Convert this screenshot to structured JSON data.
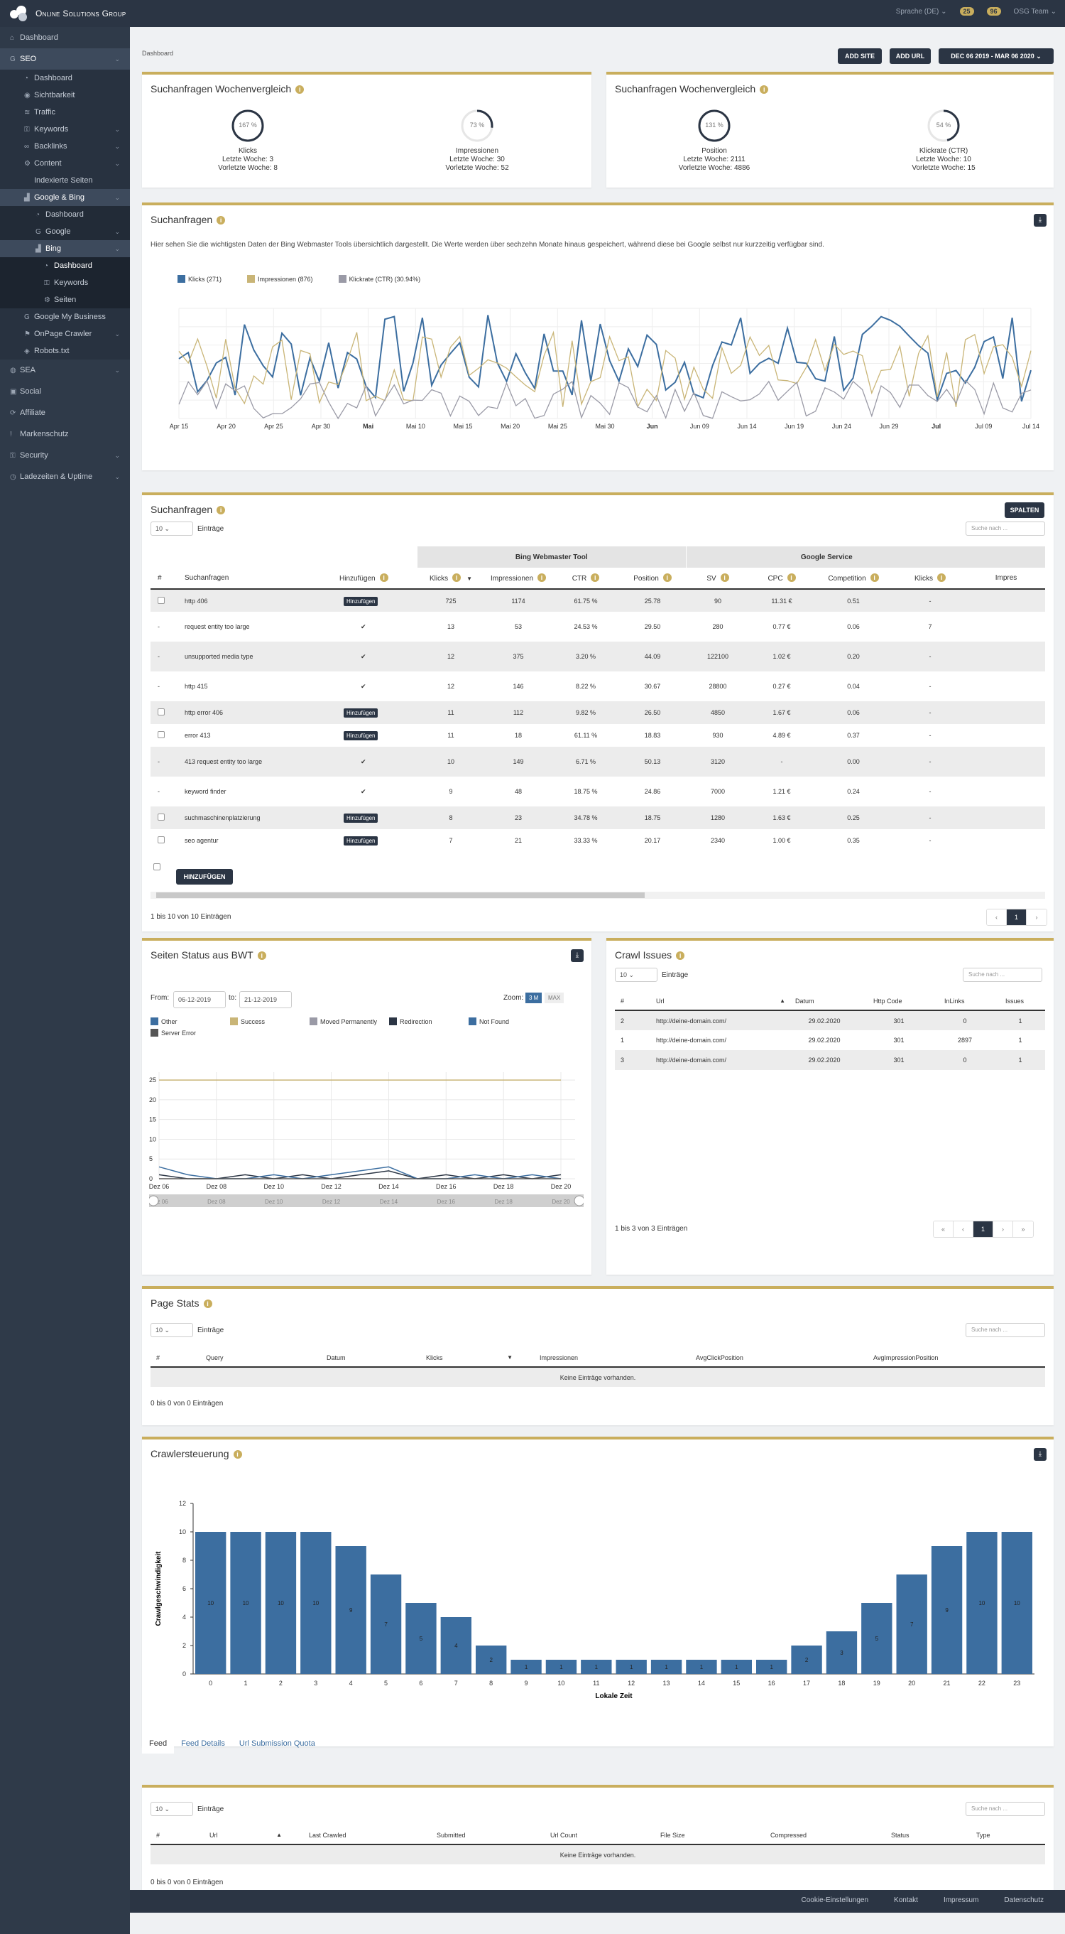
{
  "topbar": {
    "brand": "Online Solutions Group",
    "lang": "Sprache (DE)",
    "badge1": "25",
    "badge2": "96",
    "user": "OSG Team"
  },
  "sidebar": [
    {
      "label": "Dashboard",
      "icon": "home-icon",
      "level": 0
    },
    {
      "label": "SEO",
      "icon": "google-icon",
      "level": 0,
      "active": true,
      "chev": "⌄"
    },
    {
      "label": "Dashboard",
      "icon": "gauge-icon",
      "level": 1
    },
    {
      "label": "Sichtbarkeit",
      "icon": "eye-icon",
      "level": 1
    },
    {
      "label": "Traffic",
      "icon": "signal-icon",
      "level": 1
    },
    {
      "label": "Keywords",
      "icon": "key-icon",
      "level": 1,
      "chev": "⌄"
    },
    {
      "label": "Backlinks",
      "icon": "link-icon",
      "level": 1,
      "chev": "⌄"
    },
    {
      "label": "Content",
      "icon": "gear-icon",
      "level": 1,
      "chev": "⌄"
    },
    {
      "label": "Indexierte Seiten",
      "icon": "",
      "level": 1
    },
    {
      "label": "Google & Bing",
      "icon": "chart-icon",
      "level": 1,
      "active": true,
      "chev": "⌄"
    },
    {
      "label": "Dashboard",
      "icon": "gauge-icon",
      "level": 2
    },
    {
      "label": "Google",
      "icon": "google-icon",
      "level": 2,
      "chev": "⌄"
    },
    {
      "label": "Bing",
      "icon": "chart-icon",
      "level": 2,
      "active": true,
      "chev": "⌄"
    },
    {
      "label": "Dashboard",
      "icon": "gauge-icon",
      "level": 3,
      "active": true
    },
    {
      "label": "Keywords",
      "icon": "key-icon",
      "level": 3
    },
    {
      "label": "Seiten",
      "icon": "gear-icon",
      "level": 3
    },
    {
      "label": "Google My Business",
      "icon": "google-icon",
      "level": 1
    },
    {
      "label": "OnPage Crawler",
      "icon": "flag-icon",
      "level": 1,
      "chev": "⌄"
    },
    {
      "label": "Robots.txt",
      "icon": "robot-icon",
      "level": 1
    },
    {
      "label": "SEA",
      "icon": "globe-icon",
      "level": 0,
      "chev": "⌄"
    },
    {
      "label": "Social",
      "icon": "social-icon",
      "level": 0
    },
    {
      "label": "Affiliate",
      "icon": "affiliate-icon",
      "level": 0
    },
    {
      "label": "Markenschutz",
      "icon": "exclaim-icon",
      "level": 0
    },
    {
      "label": "Security",
      "icon": "lock-icon",
      "level": 0,
      "chev": "⌄"
    },
    {
      "label": "Ladezeiten & Uptime",
      "icon": "clock-icon",
      "level": 0,
      "chev": "⌄"
    }
  ],
  "header": {
    "breadcrumb": "Dashboard",
    "add_site": "ADD SITE",
    "add_url": "ADD URL",
    "date_range": "DEC 06 2019 - MAR 06 2020"
  },
  "weekly": [
    {
      "title": "Suchanfragen Wochenvergleich",
      "metrics": [
        {
          "pct": "167 %",
          "name": "Klicks",
          "last": "Letzte Woche: 3",
          "prev": "Vorletzte Woche: 8",
          "ratio": 1.0
        },
        {
          "pct": "73 %",
          "name": "Impressionen",
          "last": "Letzte Woche: 30",
          "prev": "Vorletzte Woche: 52",
          "ratio": 0.27
        }
      ]
    },
    {
      "title": "Suchanfragen Wochenvergleich",
      "metrics": [
        {
          "pct": "131 %",
          "name": "Position",
          "last": "Letzte Woche: 2111",
          "prev": "Vorletzte Woche: 4886",
          "ratio": 1.0
        },
        {
          "pct": "54 %",
          "name": "Klickrate (CTR)",
          "last": "Letzte Woche: 10",
          "prev": "Vorletzte Woche: 15",
          "ratio": 0.46
        }
      ]
    }
  ],
  "suchanfragen_chart": {
    "title": "Suchanfragen",
    "description": "Hier sehen Sie die wichtigsten Daten der Bing Webmaster Tools übersichtlich dargestellt. Die Werte werden über sechzehn Monate hinaus gespeichert, während diese bei Google selbst nur kurzzeitig verfügbar sind.",
    "legend": [
      "Klicks (271)",
      "Impressionen (876)",
      "Klickrate (CTR) (30.94%)"
    ]
  },
  "chart_data": [
    {
      "type": "line",
      "series": [
        {
          "name": "Klicks (271)",
          "color": "#3c6ea0"
        },
        {
          "name": "Impressionen (876)",
          "color": "#c9b577"
        },
        {
          "name": "Klickrate (CTR) (30.94%)",
          "color": "#9a9aa6"
        }
      ],
      "x": [
        "Apr 15",
        "Apr 20",
        "Apr 25",
        "Apr 30",
        "Mai",
        "Mai 10",
        "Mai 15",
        "Mai 20",
        "Mai 25",
        "Mai 30",
        "Jun",
        "Jun 09",
        "Jun 14",
        "Jun 19",
        "Jun 24",
        "Jun 29",
        "Jul",
        "Jul 09",
        "Jul 14"
      ]
    },
    {
      "type": "line",
      "title": "Seiten Status aus BWT",
      "series": [
        {
          "name": "Other",
          "color": "#3c6ea0"
        },
        {
          "name": "Success",
          "color": "#c9b577",
          "values": [
            25,
            25,
            25,
            25,
            25,
            25,
            25,
            25,
            25,
            25,
            25,
            25,
            25,
            25,
            25
          ]
        },
        {
          "name": "Moved Permanently",
          "color": "#9a9aa6"
        },
        {
          "name": "Redirection",
          "color": "#2b3544",
          "values": [
            1,
            0,
            0,
            1,
            0,
            1,
            0,
            1,
            2,
            0,
            1,
            0,
            1,
            0,
            1
          ]
        },
        {
          "name": "Not Found",
          "color": "#3c6ea0",
          "values": [
            3,
            1,
            0,
            0,
            1,
            0,
            1,
            2,
            3,
            0,
            0,
            1,
            0,
            1,
            0
          ]
        },
        {
          "name": "Server Error",
          "color": "#555",
          "values": [
            0,
            0,
            0,
            0,
            0,
            0,
            0,
            0,
            0,
            0,
            0,
            0,
            0,
            0,
            0
          ]
        }
      ],
      "x": [
        "Dez 06",
        "Dez 08",
        "Dez 10",
        "Dez 12",
        "Dez 14",
        "Dez 16",
        "Dez 18",
        "Dez 20"
      ],
      "yticks": [
        0,
        5,
        10,
        15,
        20,
        25
      ],
      "ylim": [
        0,
        27
      ]
    },
    {
      "type": "bar",
      "title": "Crawlersteuerung",
      "xlabel": "Lokale Zeit",
      "ylabel": "Crawlgeschwindigkeit",
      "categories": [
        "0",
        "1",
        "2",
        "3",
        "4",
        "5",
        "6",
        "7",
        "8",
        "9",
        "10",
        "11",
        "12",
        "13",
        "14",
        "15",
        "16",
        "17",
        "18",
        "19",
        "20",
        "21",
        "22",
        "23"
      ],
      "values": [
        10,
        10,
        10,
        10,
        9,
        7,
        5,
        4,
        2,
        1,
        1,
        1,
        1,
        1,
        1,
        1,
        1,
        2,
        3,
        5,
        7,
        9,
        10,
        10
      ],
      "yticks": [
        0,
        2,
        4,
        6,
        8,
        10,
        12
      ],
      "ylim": [
        0,
        12
      ],
      "color": "#3c6ea0"
    }
  ],
  "queries": {
    "title": "Suchanfragen",
    "spalten": "SPALTEN",
    "entries": "10",
    "entries_label": "Einträge",
    "search": "Suche nach ...",
    "group_bing": "Bing Webmaster Tool",
    "group_google": "Google Service",
    "cols": [
      "#",
      "Suchanfragen",
      "Hinzufügen",
      "Klicks",
      "Impressionen",
      "CTR",
      "Position",
      "SV",
      "CPC",
      "Competition",
      "Klicks",
      "Impres"
    ],
    "rows": [
      {
        "check": "box",
        "q": "http 406",
        "add": "Hinzufügen",
        "k": "725",
        "i": "1174",
        "ctr": "61.75 %",
        "pos": "25.78",
        "sv": "90",
        "cpc": "11.31 €",
        "comp": "0.51",
        "gk": "-"
      },
      {
        "check": "-",
        "q": "request entity too large",
        "add": "✔",
        "k": "13",
        "i": "53",
        "ctr": "24.53 %",
        "pos": "29.50",
        "sv": "280",
        "cpc": "0.77 €",
        "comp": "0.06",
        "gk": "7"
      },
      {
        "check": "-",
        "q": "unsupported media type",
        "add": "✔",
        "k": "12",
        "i": "375",
        "ctr": "3.20 %",
        "pos": "44.09",
        "sv": "122100",
        "cpc": "1.02 €",
        "comp": "0.20",
        "gk": "-"
      },
      {
        "check": "-",
        "q": "http 415",
        "add": "✔",
        "k": "12",
        "i": "146",
        "ctr": "8.22 %",
        "pos": "30.67",
        "sv": "28800",
        "cpc": "0.27 €",
        "comp": "0.04",
        "gk": "-"
      },
      {
        "check": "box",
        "q": "http error 406",
        "add": "Hinzufügen",
        "k": "11",
        "i": "112",
        "ctr": "9.82 %",
        "pos": "26.50",
        "sv": "4850",
        "cpc": "1.67 €",
        "comp": "0.06",
        "gk": "-"
      },
      {
        "check": "box",
        "q": "error 413",
        "add": "Hinzufügen",
        "k": "11",
        "i": "18",
        "ctr": "61.11 %",
        "pos": "18.83",
        "sv": "930",
        "cpc": "4.89 €",
        "comp": "0.37",
        "gk": "-"
      },
      {
        "check": "-",
        "q": "413 request entity too large",
        "add": "✔",
        "k": "10",
        "i": "149",
        "ctr": "6.71 %",
        "pos": "50.13",
        "sv": "3120",
        "cpc": "-",
        "comp": "0.00",
        "gk": "-"
      },
      {
        "check": "-",
        "q": "keyword finder",
        "add": "✔",
        "k": "9",
        "i": "48",
        "ctr": "18.75 %",
        "pos": "24.86",
        "sv": "7000",
        "cpc": "1.21 €",
        "comp": "0.24",
        "gk": "-"
      },
      {
        "check": "box",
        "q": "suchmaschinenplatzierung",
        "add": "Hinzufügen",
        "k": "8",
        "i": "23",
        "ctr": "34.78 %",
        "pos": "18.75",
        "sv": "1280",
        "cpc": "1.63 €",
        "comp": "0.25",
        "gk": "-"
      },
      {
        "check": "box",
        "q": "seo agentur",
        "add": "Hinzufügen",
        "k": "7",
        "i": "21",
        "ctr": "33.33 %",
        "pos": "20.17",
        "sv": "2340",
        "cpc": "1.00 €",
        "comp": "0.35",
        "gk": "-"
      }
    ],
    "add_btn": "HINZUFÜGEN",
    "info": "1 bis 10 von 10 Einträgen",
    "page": "1",
    "prev": "‹",
    "next": "›"
  },
  "bwt": {
    "title": "Seiten Status aus BWT",
    "from_label": "From:",
    "from": "06-12-2019",
    "to_label": "to:",
    "to": "21-12-2019",
    "zoom": "Zoom:",
    "zoom_3m": "3 M",
    "zoom_max": "MAX",
    "legend": [
      "Other",
      "Success",
      "Moved Permanently",
      "Redirection",
      "Not Found",
      "Server Error"
    ]
  },
  "crawl": {
    "title": "Crawl Issues",
    "entries": "10",
    "entries_label": "Einträge",
    "search": "Suche nach ...",
    "cols": [
      "#",
      "Url",
      "Datum",
      "Http Code",
      "InLinks",
      "Issues"
    ],
    "rows": [
      {
        "n": "2",
        "url": "http://deine-domain.com/",
        "date": "29.02.2020",
        "code": "301",
        "inl": "0",
        "iss": "1"
      },
      {
        "n": "1",
        "url": "http://deine-domain.com/",
        "date": "29.02.2020",
        "code": "301",
        "inl": "2897",
        "iss": "1"
      },
      {
        "n": "3",
        "url": "http://deine-domain.com/",
        "date": "29.02.2020",
        "code": "301",
        "inl": "0",
        "iss": "1"
      }
    ],
    "info": "1 bis 3 von 3 Einträgen",
    "pages": [
      "«",
      "‹",
      "1",
      "›",
      "»"
    ]
  },
  "pagestats": {
    "title": "Page Stats",
    "entries": "10",
    "entries_label": "Einträge",
    "search": "Suche nach ...",
    "cols": [
      "#",
      "Query",
      "Datum",
      "Klicks",
      "Impressionen",
      "AvgClickPosition",
      "AvgImpressionPosition"
    ],
    "empty": "Keine Einträge vorhanden.",
    "info": "0 bis 0 von 0 Einträgen"
  },
  "crawler": {
    "title": "Crawlersteuerung"
  },
  "feed": {
    "tabs": [
      "Feed",
      "Feed Details",
      "Url Submission Quota"
    ],
    "entries": "10",
    "entries_label": "Einträge",
    "search": "Suche nach ...",
    "cols": [
      "#",
      "Url",
      "Last Crawled",
      "Submitted",
      "Url Count",
      "File Size",
      "Compressed",
      "Status",
      "Type"
    ],
    "empty": "Keine Einträge vorhanden.",
    "info": "0 bis 0 von 0 Einträgen"
  },
  "footer": [
    "Cookie-Einstellungen",
    "Kontakt",
    "Impressum",
    "Datenschutz"
  ]
}
